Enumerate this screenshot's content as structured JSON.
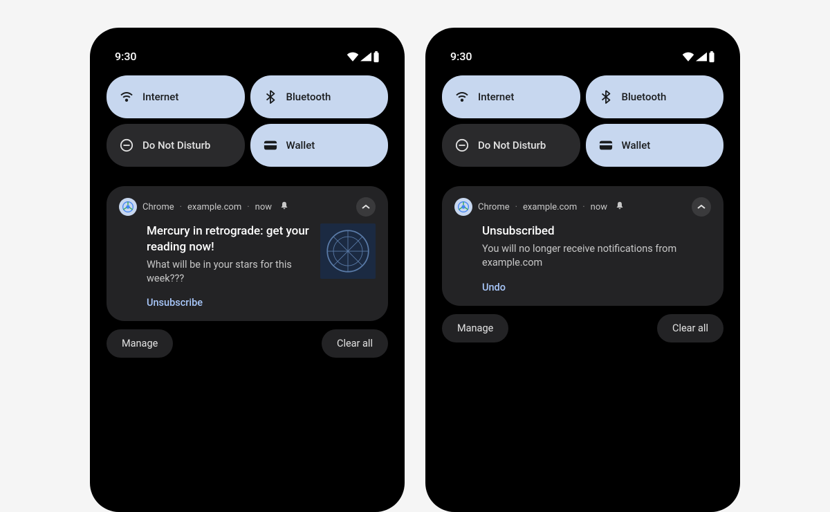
{
  "status": {
    "time": "9:30"
  },
  "quickSettings": {
    "internet": "Internet",
    "bluetooth": "Bluetooth",
    "dnd": "Do Not Disturb",
    "wallet": "Wallet"
  },
  "phone1": {
    "notif": {
      "app": "Chrome",
      "site": "example.com",
      "when": "now",
      "title": "Mercury in retrograde: get your reading now!",
      "body": "What will be in your stars for this week???",
      "action": "Unsubscribe"
    }
  },
  "phone2": {
    "notif": {
      "app": "Chrome",
      "site": "example.com",
      "when": "now",
      "title": "Unsubscribed",
      "body": "You will no longer receive notifications from example.com",
      "action": "Undo"
    }
  },
  "bottom": {
    "manage": "Manage",
    "clearAll": "Clear all"
  }
}
